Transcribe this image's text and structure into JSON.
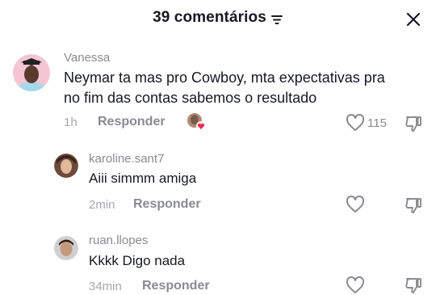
{
  "header": {
    "title": "39 comentários",
    "sort_icon": "sort-lines-icon",
    "close_icon": "close-icon"
  },
  "comments": [
    {
      "username": "Vanessa",
      "text_line1": "Neymar ta mas pro Cowboy, mta expectativas pra",
      "text_line2": "no fim das contas sabemos o resultado",
      "time": "1h",
      "reply_label": "Responder",
      "likes": "115",
      "creator_liked": true
    }
  ],
  "replies": [
    {
      "username": "karoline.sant7",
      "text": "Aiii simmm amiga",
      "time": "2min",
      "reply_label": "Responder"
    },
    {
      "username": "ruan.llopes",
      "text": "Kkkk Digo nada",
      "time": "34min",
      "reply_label": "Responder"
    }
  ],
  "colors": {
    "text_primary": "#161823",
    "text_secondary": "#8a8b91",
    "heart_red": "#fe2c55"
  }
}
